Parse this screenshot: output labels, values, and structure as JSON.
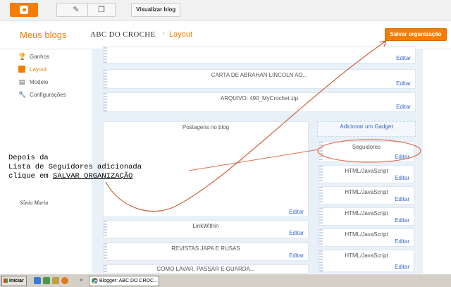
{
  "toolbar": {
    "view_blog_label": "Visualizar blog"
  },
  "header": {
    "my_blogs": "Meus blogs",
    "blog_title": "ABC DO CROCHE",
    "separator": "·",
    "page_title": "Layout",
    "save_label": "Salvar organização"
  },
  "sidebar": {
    "items": [
      {
        "label": "Ganhos",
        "icon": "trophy-icon"
      },
      {
        "label": "Layout",
        "icon": "layout-icon"
      },
      {
        "label": "Modelo",
        "icon": "template-icon"
      },
      {
        "label": "Configurações",
        "icon": "wrench-icon"
      }
    ]
  },
  "layout": {
    "edit_label": "Editar",
    "top_gadgets": [
      {
        "title": ""
      },
      {
        "title": "CARTA DE ABRAHAN LINCOLN AO..."
      },
      {
        "title": "ARQUIVO: 490_MyCrochet.zip"
      }
    ],
    "main_gadgets": [
      {
        "title": "Postagens no blog"
      },
      {
        "title": "LinkWithin"
      },
      {
        "title": "REVISTAS JAPA E RUSAS"
      },
      {
        "title": "COMO LAVAR, PASSAR E GUARDA..."
      }
    ],
    "add_gadget_label": "Adicionar um Gadget",
    "side_gadgets": [
      {
        "title": "Seguidores"
      },
      {
        "title": "HTML/JavaScript"
      },
      {
        "title": "HTML/JavaScript"
      },
      {
        "title": "HTML/JavaScript"
      },
      {
        "title": "HTML/JavaScript"
      },
      {
        "title": "HTML/JavaScript"
      }
    ]
  },
  "annotation": {
    "line1": "Depois da",
    "line2": "Lista de Seguidores adicionada",
    "line3_prefix": "clique em ",
    "line3_emphasis": "SALVAR ORGANIZAÇÃO",
    "signature": "Sônia Maria",
    "arrow_color": "#c8643c",
    "circle_color": "#e07050"
  },
  "taskbar": {
    "start_label": "Iniciar",
    "separator": "»",
    "task_label": "Blogger: ABC DO CROC..."
  },
  "colors": {
    "accent": "#f57d00",
    "link": "#3366cc",
    "canvas": "#e8f0f8"
  }
}
